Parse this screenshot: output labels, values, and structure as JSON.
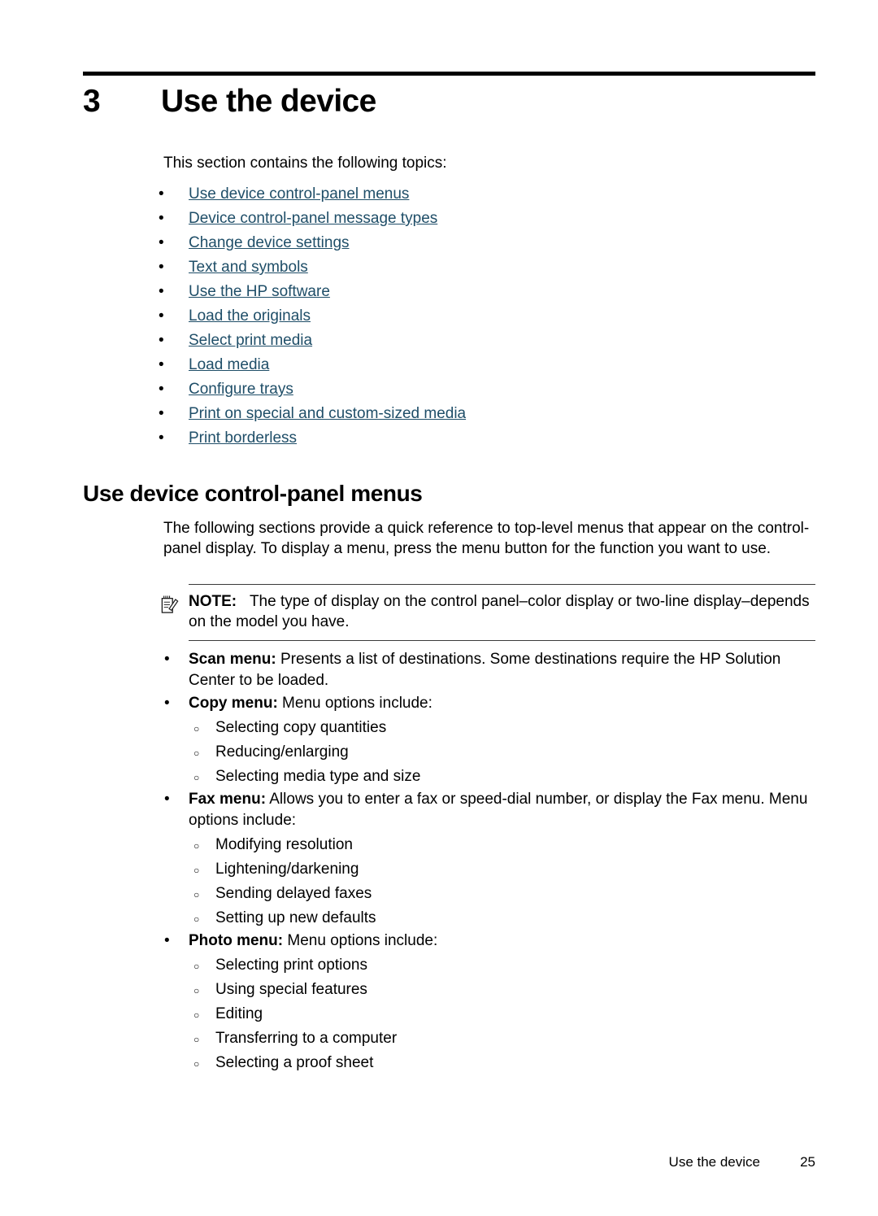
{
  "document": {
    "chapter_number": "3",
    "chapter_title": "Use the device",
    "intro": "This section contains the following topics:",
    "link_color": "#1f4e68",
    "rule_color": "#000000"
  },
  "topics": [
    {
      "bullet": "•",
      "label": "Use device control-panel menus"
    },
    {
      "bullet": "•",
      "label": "Device control-panel message types"
    },
    {
      "bullet": "•",
      "label": "Change device settings"
    },
    {
      "bullet": "•",
      "label": "Text and symbols"
    },
    {
      "bullet": "•",
      "label": "Use the HP software"
    },
    {
      "bullet": "•",
      "label": "Load the originals"
    },
    {
      "bullet": "•",
      "label": "Select print media"
    },
    {
      "bullet": "•",
      "label": "Load media"
    },
    {
      "bullet": "•",
      "label": "Configure trays"
    },
    {
      "bullet": "•",
      "label": "Print on special and custom-sized media"
    },
    {
      "bullet": "•",
      "label": "Print borderless"
    }
  ],
  "section": {
    "heading": "Use device control-panel menus",
    "paragraph": "The following sections provide a quick reference to top-level menus that appear on the control-panel display. To display a menu, press the menu button for the function you want to use."
  },
  "note": {
    "icon": "note-pencil-icon",
    "label": "NOTE:",
    "text": "The type of display on the control panel–color display or two-line display–depends on the model you have."
  },
  "menus": [
    {
      "bullet": "•",
      "title": "Scan menu:",
      "description": " Presents a list of destinations. Some destinations require the HP Solution Center to be loaded.",
      "sub_bullet": "○",
      "sub_items": []
    },
    {
      "bullet": "•",
      "title": "Copy menu:",
      "description": " Menu options include:",
      "sub_bullet": "○",
      "sub_items": [
        "Selecting copy quantities",
        "Reducing/enlarging",
        "Selecting media type and size"
      ]
    },
    {
      "bullet": "•",
      "title": "Fax menu:",
      "description": " Allows you to enter a fax or speed-dial number, or display the Fax menu. Menu options include:",
      "sub_bullet": "○",
      "sub_items": [
        "Modifying resolution",
        "Lightening/darkening",
        "Sending delayed faxes",
        "Setting up new defaults"
      ]
    },
    {
      "bullet": "•",
      "title": "Photo menu:",
      "description": " Menu options include:",
      "sub_bullet": "○",
      "sub_items": [
        "Selecting print options",
        "Using special features",
        "Editing",
        "Transferring to a computer",
        "Selecting a proof sheet"
      ]
    }
  ],
  "footer": {
    "label": "Use the device",
    "page_number": "25"
  }
}
